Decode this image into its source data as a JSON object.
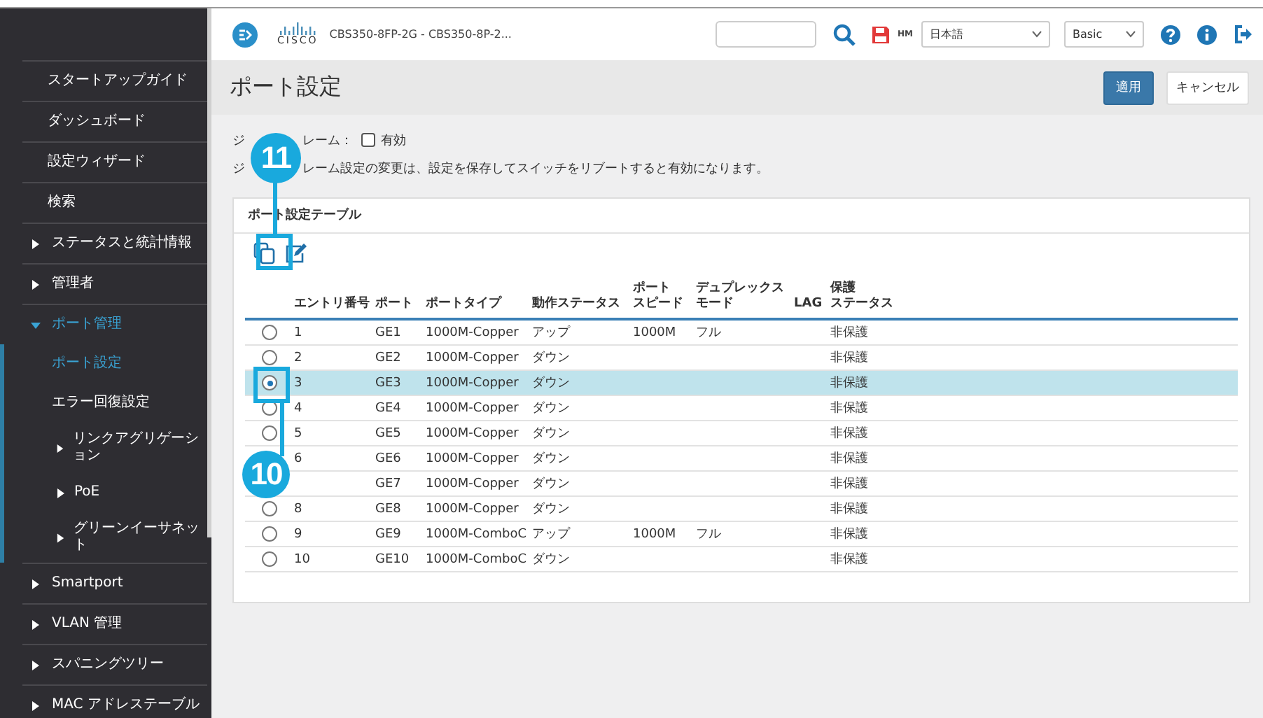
{
  "header": {
    "logo": "CISCO",
    "title": "CBS350-8FP-2G - CBS350-8P-2...",
    "badge": "HM",
    "language": "日本語",
    "mode": "Basic"
  },
  "sidebar": {
    "items": [
      {
        "label": "スタートアップガイド",
        "kind": "leaf",
        "selected": false
      },
      {
        "label": "ダッシュボード",
        "kind": "leaf",
        "selected": false
      },
      {
        "label": "設定ウィザード",
        "kind": "leaf",
        "selected": false
      },
      {
        "label": "検索",
        "kind": "leaf",
        "selected": false
      },
      {
        "label": "ステータスと統計情報",
        "kind": "branch",
        "expanded": false
      },
      {
        "label": "管理者",
        "kind": "branch",
        "expanded": false
      },
      {
        "label": "ポート管理",
        "kind": "branch",
        "expanded": true,
        "children": [
          {
            "label": "ポート設定",
            "kind": "leaf",
            "selected": true
          },
          {
            "label": "エラー回復設定",
            "kind": "leaf",
            "selected": false
          },
          {
            "label": "リンクアグリゲーション",
            "kind": "branch",
            "expanded": false
          },
          {
            "label": "PoE",
            "kind": "branch",
            "expanded": false
          },
          {
            "label": "グリーンイーサネット",
            "kind": "branch",
            "expanded": false
          }
        ]
      },
      {
        "label": "Smartport",
        "kind": "branch",
        "expanded": false
      },
      {
        "label": "VLAN 管理",
        "kind": "branch",
        "expanded": false
      },
      {
        "label": "スパニングツリー",
        "kind": "branch",
        "expanded": false
      },
      {
        "label": "MAC アドレステーブル",
        "kind": "branch",
        "expanded": false
      }
    ]
  },
  "page": {
    "title": "ポート設定",
    "buttons": [
      {
        "label": "適用",
        "kind": "primary"
      },
      {
        "label": "キャンセル",
        "kind": "secondary"
      }
    ]
  },
  "jumbo": {
    "label_parts": [
      "ジ",
      "レーム："
    ],
    "checkbox": {
      "label": "有効",
      "checked": false
    },
    "note_parts": [
      "ジ",
      "レーム設定の変更は、設定を保存してスイッチをリブートすると有効になります。"
    ]
  },
  "table": {
    "title": "ポート設定テーブル",
    "columns": [
      [
        "エントリ番号"
      ],
      [
        "ポート"
      ],
      [
        "ポートタイプ"
      ],
      [
        "動作ステータス"
      ],
      [
        "ポート",
        "スピード"
      ],
      [
        "デュプレックス",
        "モード"
      ],
      [
        "LAG"
      ],
      [
        "保護",
        "ステータス"
      ]
    ],
    "rows": [
      {
        "selected": false,
        "entry": "1",
        "port": "GE1",
        "type": "1000M-Copper",
        "status": "アップ",
        "speed": "1000M",
        "duplex": "フル",
        "protection": "非保護"
      },
      {
        "selected": false,
        "entry": "2",
        "port": "GE2",
        "type": "1000M-Copper",
        "status": "ダウン",
        "protection": "非保護"
      },
      {
        "selected": true,
        "entry": "3",
        "port": "GE3",
        "type": "1000M-Copper",
        "status": "ダウン",
        "protection": "非保護"
      },
      {
        "selected": false,
        "entry": "4",
        "port": "GE4",
        "type": "1000M-Copper",
        "status": "ダウン",
        "protection": "非保護"
      },
      {
        "selected": false,
        "entry": "5",
        "port": "GE5",
        "type": "1000M-Copper",
        "status": "ダウン",
        "protection": "非保護"
      },
      {
        "entry": "6",
        "port": "GE6",
        "type": "1000M-Copper",
        "status": "ダウン",
        "protection": "非保護"
      },
      {
        "port": "GE7",
        "type": "1000M-Copper",
        "status": "ダウン",
        "protection": "非保護"
      },
      {
        "selected": false,
        "entry": "8",
        "port": "GE8",
        "type": "1000M-Copper",
        "status": "ダウン",
        "protection": "非保護"
      },
      {
        "selected": false,
        "entry": "9",
        "port": "GE9",
        "type": "1000M-ComboC",
        "status": "アップ",
        "speed": "1000M",
        "duplex": "フル",
        "protection": "非保護"
      },
      {
        "selected": false,
        "entry": "10",
        "port": "GE10",
        "type": "1000M-ComboC",
        "status": "ダウン",
        "protection": "非保護"
      }
    ]
  },
  "callouts": [
    {
      "number": "11"
    },
    {
      "number": "10"
    }
  ]
}
